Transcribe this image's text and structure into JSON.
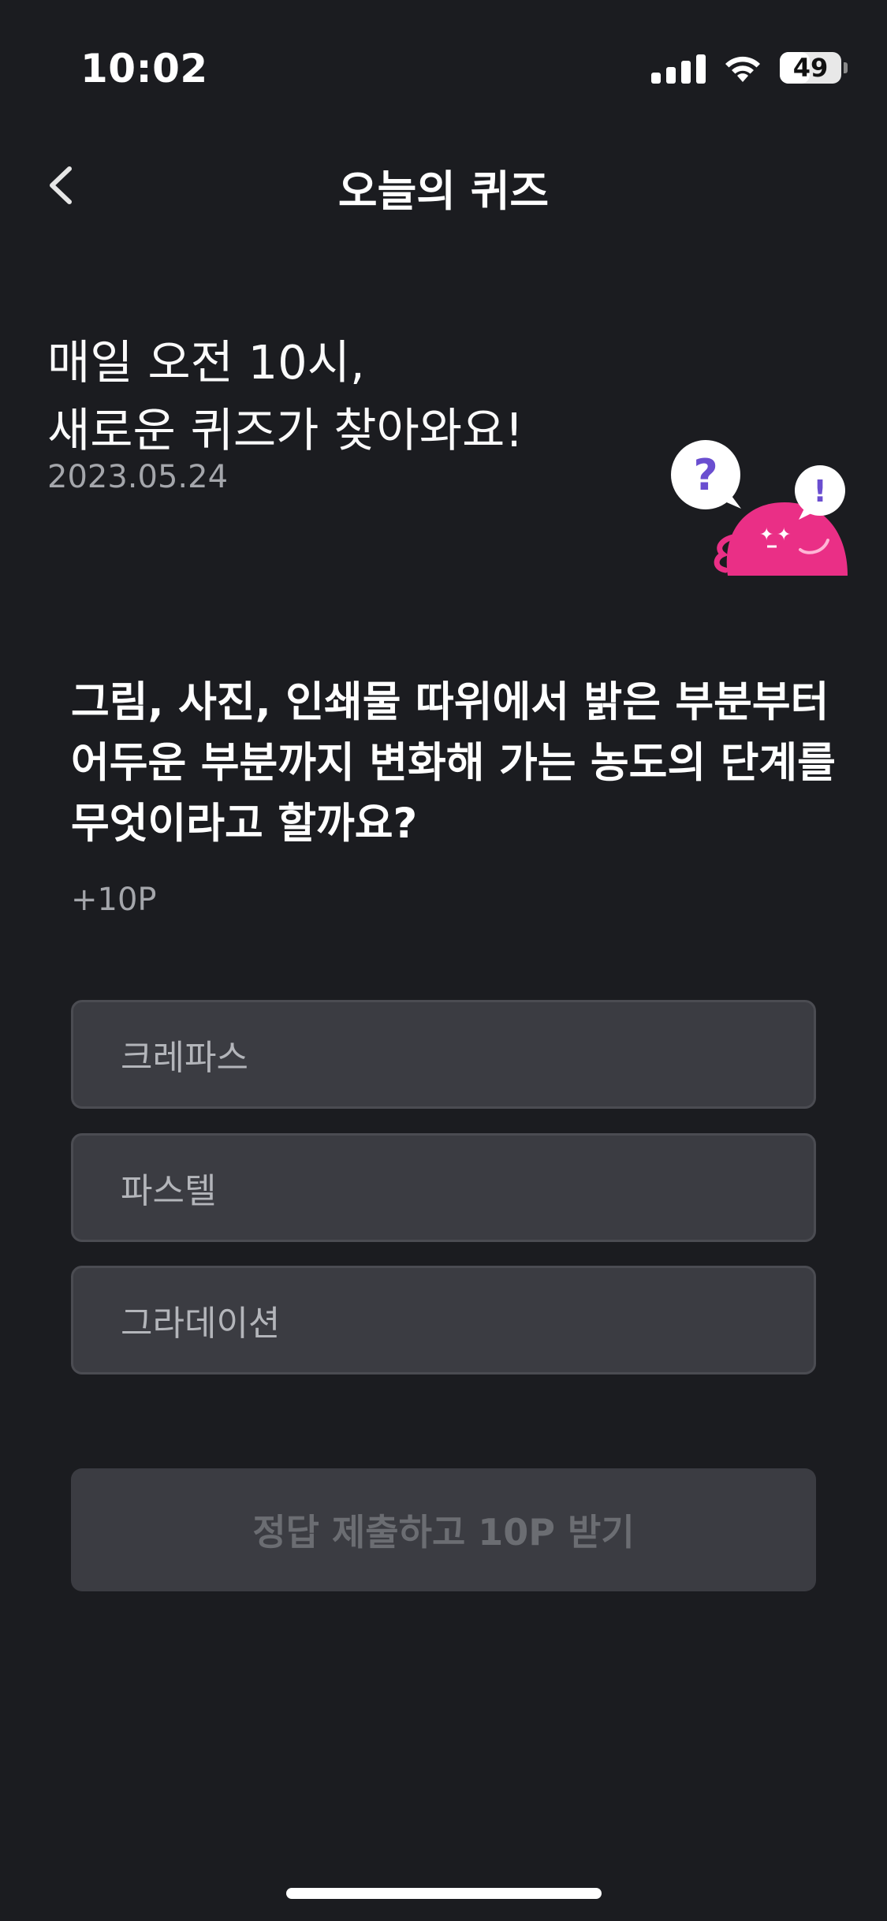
{
  "status_bar": {
    "time": "10:02",
    "battery_level": "49",
    "battery_fraction": 0.49
  },
  "nav": {
    "title": "오늘의 퀴즈",
    "back_icon": "chevron-left-icon"
  },
  "intro": {
    "line1": "매일 오전 10시,",
    "line2": "새로운 퀴즈가 찾아와요!",
    "date": "2023.05.24"
  },
  "mascot": {
    "bubble_question": "?",
    "bubble_exclaim": "!",
    "color": "#ea2f86"
  },
  "quiz": {
    "question": "그림, 사진, 인쇄물 따위에서 밝은 부분부터 어두운 부분까지 변화해 가는 농도의 단계를 무엇이라고 할까요?",
    "points": "+10P",
    "options": [
      {
        "label": "크레파스"
      },
      {
        "label": "파스텔"
      },
      {
        "label": "그라데이션"
      }
    ],
    "submit_label": "정답 제출하고 10P 받기"
  },
  "colors": {
    "background": "#1b1c20",
    "option_bg": "#3b3c42",
    "mascot_pink": "#ea2f86",
    "bubble_icon": "#6a4ed0"
  }
}
